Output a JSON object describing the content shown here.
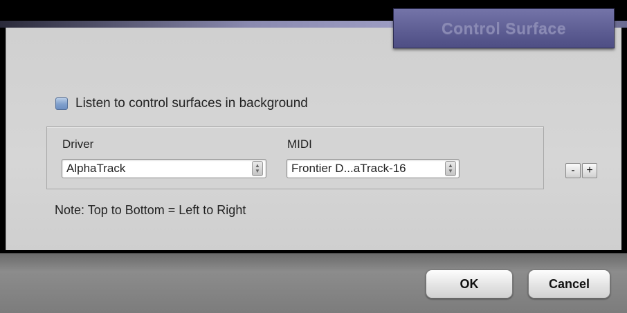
{
  "title_tab": {
    "text": "Control Surface"
  },
  "background_checkbox": {
    "label": "Listen to control surfaces in background",
    "checked": false
  },
  "surface_group": {
    "driver": {
      "label": "Driver",
      "value": "AlphaTrack"
    },
    "midi": {
      "label": "MIDI",
      "value": "Frontier D...aTrack-16"
    }
  },
  "row_buttons": {
    "remove_label": "-",
    "add_label": "+"
  },
  "note": "Note: Top to Bottom = Left to Right",
  "dialog_buttons": {
    "ok_label": "OK",
    "cancel_label": "Cancel"
  },
  "colors": {
    "title_tab": "#5c5c92",
    "panel": "#d2d2d2",
    "checkbox": "#7f9fcc"
  }
}
